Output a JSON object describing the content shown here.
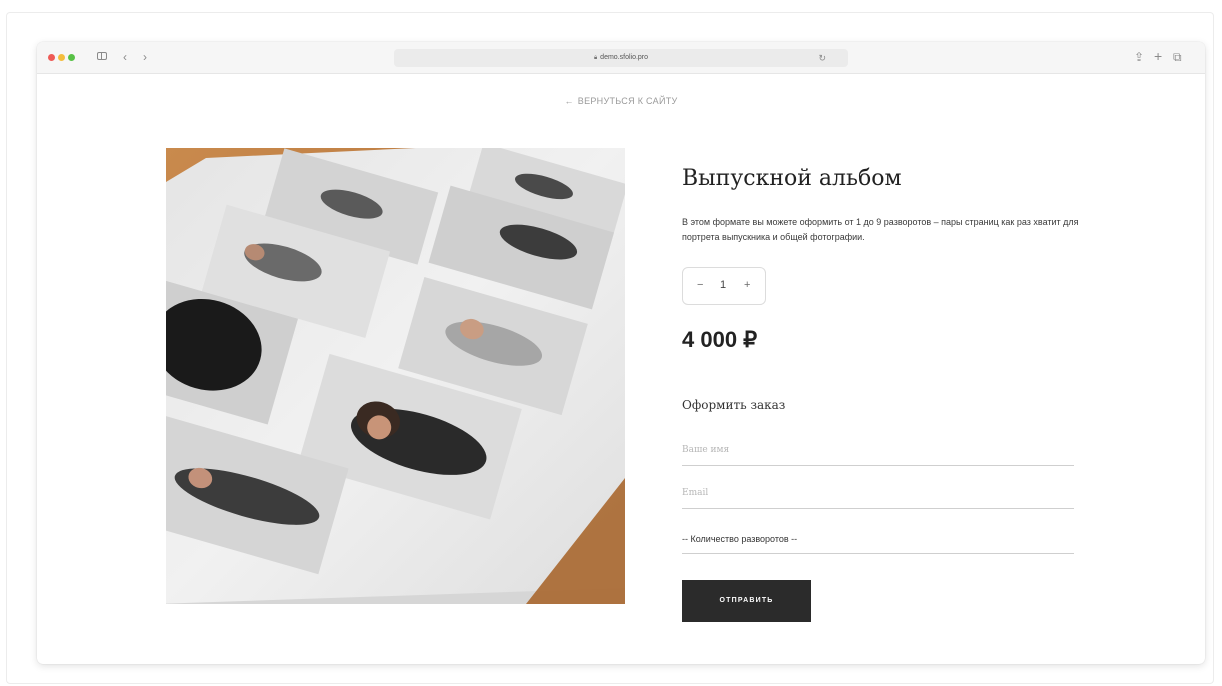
{
  "browser": {
    "url": "demo.sfolio.pro",
    "icons": [
      "lock-icon",
      "reload-icon",
      "share-icon",
      "new-tab-icon",
      "tabs-icon"
    ]
  },
  "page": {
    "back_link": "ВЕРНУТЬСЯ К САЙТУ",
    "back_arrow": "←",
    "title": "Выпускной альбом",
    "description": "В этом формате вы можете оформить от 1 до 9 разворотов – пары страниц как раз хватит для портрета выпускника и общей фотографии.",
    "quantity": {
      "minus": "−",
      "value": "1",
      "plus": "+"
    },
    "price": "4 000 ₽"
  },
  "form": {
    "title": "Оформить заказ",
    "name_placeholder": "Ваше имя",
    "email_placeholder": "Email",
    "spreads_select": "-- Количество разворотов --",
    "submit_label": "ОТПРАВИТЬ"
  },
  "colors": {
    "button_bg": "#2b2b2b",
    "text_main": "#222222",
    "muted": "#9a9a9a"
  }
}
